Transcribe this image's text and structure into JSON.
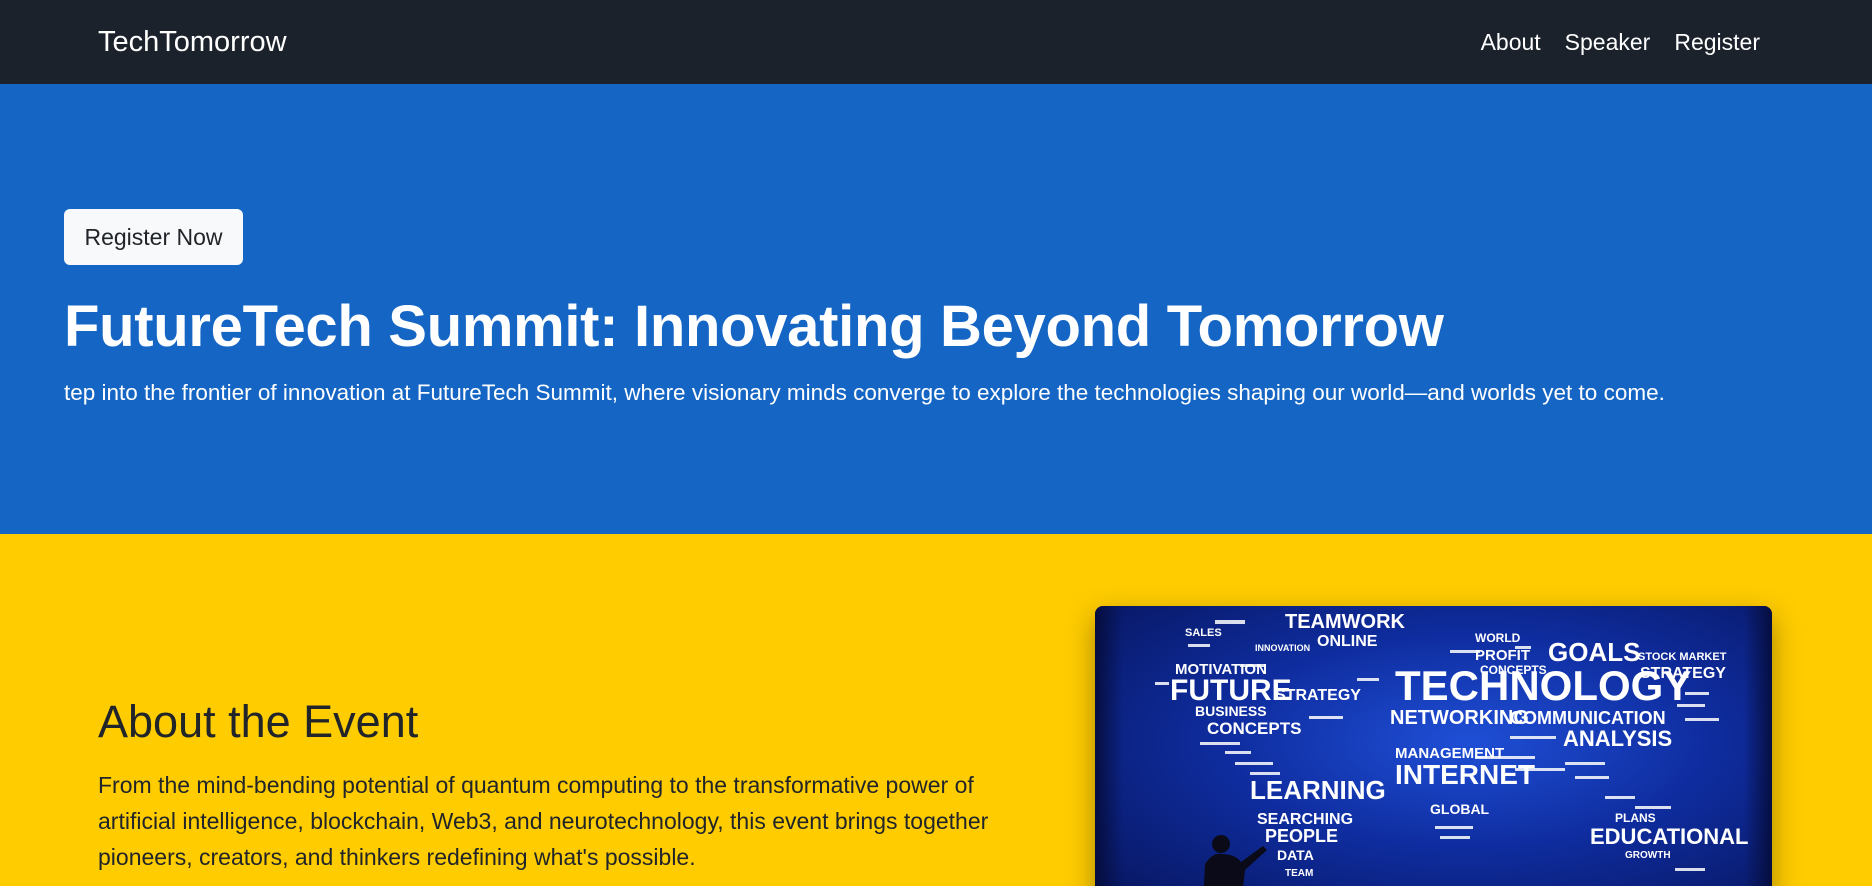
{
  "navbar": {
    "brand": "TechTomorrow",
    "links": [
      "About",
      "Speaker",
      "Register"
    ]
  },
  "hero": {
    "button_label": "Register Now",
    "title": "FutureTech Summit: Innovating Beyond Tomorrow",
    "subtitle": "tep into the frontier of innovation at FutureTech Summit, where visionary minds converge to explore the technologies shaping our world—and worlds yet to come."
  },
  "about": {
    "title": "About the Event",
    "text": "From the mind-bending potential of quantum computing to the transformative power of artificial intelligence, blockchain, Web3, and neurotechnology, this event brings together pioneers, creators, and thinkers redefining what's possible.",
    "image": {
      "words": {
        "teamwork": "TEAMWORK",
        "online": "ONLINE",
        "world": "WORLD",
        "sales": "SALES",
        "innovation": "INNOVATION",
        "motivation": "MOTIVATION",
        "future": "FUTURE",
        "strategy_left": "STRATEGY",
        "business": "BUSINESS",
        "concepts_left": "CONCEPTS",
        "profit": "PROFIT",
        "concepts": "CONCEPTS",
        "goals": "GOALS",
        "technology": "TECHNOLOGY",
        "stock_market": "STOCK MARKET",
        "strategy": "STRATEGY",
        "networking": "NETWORKING",
        "communication": "COMMUNICATION",
        "analysis": "ANALYSIS",
        "management": "MANAGEMENT",
        "internet": "INTERNET",
        "learning": "LEARNING",
        "searching": "SEARCHING",
        "people": "PEOPLE",
        "data": "DATA",
        "team": "TEAM",
        "global": "GLOBAL",
        "educational": "EDUCATIONAL",
        "plans": "PLANS",
        "growth": "GROWTH"
      }
    }
  }
}
